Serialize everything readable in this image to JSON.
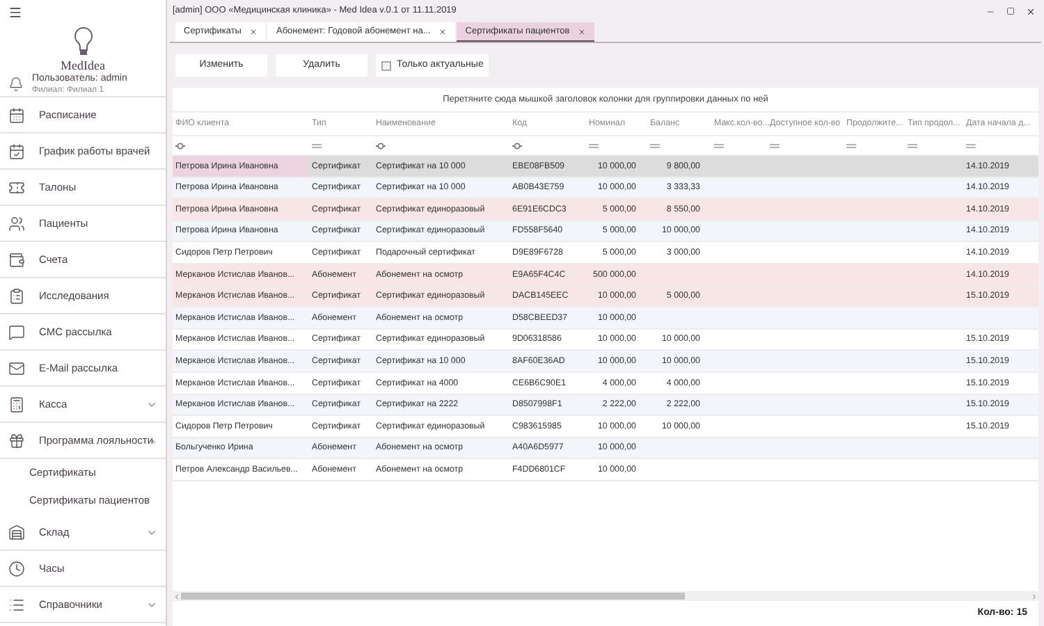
{
  "sidebar": {
    "logo": "MedIdea",
    "user": "Пользователь: admin",
    "branch": "Филиал: Филиал 1",
    "items": [
      {
        "label": "Расписание"
      },
      {
        "label": "График работы врачей"
      },
      {
        "label": "Талоны"
      },
      {
        "label": "Пациенты"
      },
      {
        "label": "Счета"
      },
      {
        "label": "Исследования"
      },
      {
        "label": "СМС рассылка"
      },
      {
        "label": "E-Mail рассылка"
      },
      {
        "label": "Касса",
        "expanded": false
      },
      {
        "label": "Программа лояльности",
        "expanded": true,
        "children": [
          {
            "label": "Сертификаты"
          },
          {
            "label": "Сертификаты пациентов"
          }
        ]
      },
      {
        "label": "Склад",
        "expanded": false
      },
      {
        "label": "Часы"
      },
      {
        "label": "Справочники",
        "expanded": false
      }
    ]
  },
  "window": {
    "title": "[admin] ООО «Медицинская клиника» - Med Idea v.0.1 от 11.11.2019"
  },
  "tabs": [
    {
      "label": "Сертификаты",
      "selected": false
    },
    {
      "label": "Абонемент: Годовой абонемент на...",
      "selected": false
    },
    {
      "label": "Сертификаты пациентов",
      "selected": true
    }
  ],
  "toolbar": {
    "buttons": [
      "Изменить",
      "Удалить"
    ],
    "checkbox": {
      "label": "Только актуальные",
      "checked": false
    }
  },
  "group_panel": "Перетяните сюда мышкой заголовок колонки для группировки данных по ней",
  "table": {
    "columns": [
      {
        "label": "ФИО клиента",
        "kind": "text"
      },
      {
        "label": "Тип",
        "kind": "list"
      },
      {
        "label": "Наименование",
        "kind": "text"
      },
      {
        "label": "Код",
        "kind": "text"
      },
      {
        "label": "Номинал",
        "kind": "list"
      },
      {
        "label": "Баланс",
        "kind": "list"
      },
      {
        "label": "Макс.кол-во...",
        "kind": "list"
      },
      {
        "label": "Доступное кол-во",
        "kind": "list"
      },
      {
        "label": "Продолжите...",
        "kind": "list"
      },
      {
        "label": "Тип продол...",
        "kind": "list"
      },
      {
        "label": "Дата начала д...",
        "kind": "list"
      }
    ],
    "rows": [
      {
        "selected": true,
        "highlighted": false,
        "cells": [
          "Петрова Ирина Ивановна",
          "Сертификат",
          "Сертификат на 10 000",
          "EBE08FB509",
          "10 000,00",
          "9 800,00",
          "",
          "",
          "",
          "",
          "14.10.2019"
        ]
      },
      {
        "selected": false,
        "highlighted": false,
        "cells": [
          "Петрова Ирина Ивановна",
          "Сертификат",
          "Сертификат на 10 000",
          "AB0B43E759",
          "10 000,00",
          "3 333,33",
          "",
          "",
          "",
          "",
          "14.10.2019"
        ]
      },
      {
        "selected": false,
        "highlighted": true,
        "cells": [
          "Петрова Ирина Ивановна",
          "Сертификат",
          "Сертификат единоразовый",
          "6E91E6CDC3",
          "5 000,00",
          "8 550,00",
          "",
          "",
          "",
          "",
          "14.10.2019"
        ]
      },
      {
        "selected": false,
        "highlighted": false,
        "cells": [
          "Петрова Ирина Ивановна",
          "Сертификат",
          "Сертификат единоразовый",
          "FD558F5640",
          "5 000,00",
          "10 000,00",
          "",
          "",
          "",
          "",
          "14.10.2019"
        ]
      },
      {
        "selected": false,
        "highlighted": false,
        "cells": [
          "Сидоров Петр Петрович",
          "Сертификат",
          "Подарочный сертификат",
          "D9E89F6728",
          "5 000,00",
          "3 000,00",
          "",
          "",
          "",
          "",
          "14.10.2019"
        ]
      },
      {
        "selected": false,
        "highlighted": true,
        "cells": [
          "Мерканов Истислав Иванов...",
          "Абонемент",
          "Абонемент на осмотр",
          "E9A65F4C4C",
          "500 000,00",
          "",
          "",
          "",
          "",
          "",
          "14.10.2019"
        ]
      },
      {
        "selected": false,
        "highlighted": true,
        "cells": [
          "Мерканов Истислав Иванов...",
          "Сертификат",
          "Сертификат единоразовый",
          "DACB145EEC",
          "10 000,00",
          "5 000,00",
          "",
          "",
          "",
          "",
          "15.10.2019"
        ]
      },
      {
        "selected": false,
        "highlighted": false,
        "cells": [
          "Мерканов Истислав Иванов...",
          "Абонемент",
          "Абонемент на осмотр",
          "D58CBEED37",
          "10 000,00",
          "",
          "",
          "",
          "",
          "",
          ""
        ]
      },
      {
        "selected": false,
        "highlighted": false,
        "cells": [
          "Мерканов Истислав Иванов...",
          "Сертификат",
          "Сертификат единоразовый",
          "9D06318586",
          "10 000,00",
          "10 000,00",
          "",
          "",
          "",
          "",
          "15.10.2019"
        ]
      },
      {
        "selected": false,
        "highlighted": false,
        "cells": [
          "Мерканов Истислав Иванов...",
          "Сертификат",
          "Сертификат на 10 000",
          "8AF60E36AD",
          "10 000,00",
          "10 000,00",
          "",
          "",
          "",
          "",
          "15.10.2019"
        ]
      },
      {
        "selected": false,
        "highlighted": false,
        "cells": [
          "Мерканов Истислав Иванов...",
          "Сертификат",
          "Сертификат на 4000",
          "CE6B6C90E1",
          "4 000,00",
          "4 000,00",
          "",
          "",
          "",
          "",
          "15.10.2019"
        ]
      },
      {
        "selected": false,
        "highlighted": false,
        "cells": [
          "Мерканов Истислав Иванов...",
          "Сертификат",
          "Сертификат на 2222",
          "D8507998F1",
          "2 222,00",
          "2 222,00",
          "",
          "",
          "",
          "",
          "15.10.2019"
        ]
      },
      {
        "selected": false,
        "highlighted": false,
        "cells": [
          "Сидоров Петр Петрович",
          "Сертификат",
          "Сертификат единоразовый",
          "C983615985",
          "10 000,00",
          "10 000,00",
          "",
          "",
          "",
          "",
          "15.10.2019"
        ]
      },
      {
        "selected": false,
        "highlighted": false,
        "cells": [
          "Больгученко Ирина",
          "Абонемент",
          "Абонемент на осмотр",
          "A40A6D5977",
          "10 000,00",
          "",
          "",
          "",
          "",
          "",
          ""
        ]
      },
      {
        "selected": false,
        "highlighted": false,
        "cells": [
          "Петров Александр Васильев...",
          "Абонемент",
          "Абонемент на осмотр",
          "F4DD6801CF",
          "10 000,00",
          "",
          "",
          "",
          "",
          "",
          ""
        ]
      }
    ]
  },
  "status_bar": "Кол-во: 15"
}
